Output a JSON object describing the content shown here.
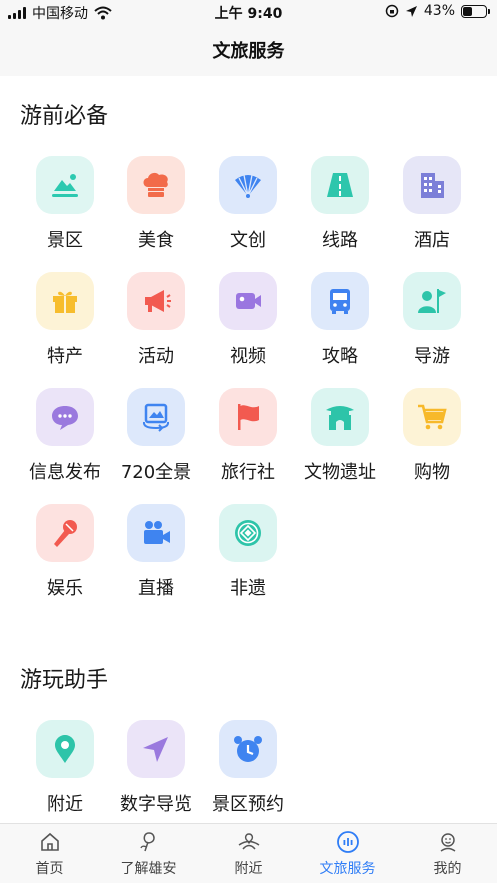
{
  "status": {
    "carrier": "中国移动",
    "time": "上午 9:40",
    "battery": "43%",
    "battery_level": 0.43
  },
  "nav": {
    "title": "文旅服务"
  },
  "sections": [
    {
      "title": "游前必备",
      "items": [
        {
          "label": "景区",
          "icon": "landscape-icon",
          "bg": "#dff6f2",
          "fg": "#2cc9b0"
        },
        {
          "label": "美食",
          "icon": "chef-hat-icon",
          "bg": "#fde3dc",
          "fg": "#f26b4a"
        },
        {
          "label": "文创",
          "icon": "fan-icon",
          "bg": "#dde8fb",
          "fg": "#3f84f0"
        },
        {
          "label": "线路",
          "icon": "road-icon",
          "bg": "#dcf5f0",
          "fg": "#2ec6ac"
        },
        {
          "label": "酒店",
          "icon": "building-icon",
          "bg": "#e6e6f7",
          "fg": "#7c7fd8"
        },
        {
          "label": "特产",
          "icon": "gift-icon",
          "bg": "#fdf3d6",
          "fg": "#f7bd2d"
        },
        {
          "label": "活动",
          "icon": "megaphone-icon",
          "bg": "#fde2e0",
          "fg": "#f25a50"
        },
        {
          "label": "视频",
          "icon": "video-camera-icon",
          "bg": "#ebe3f8",
          "fg": "#9a76e0"
        },
        {
          "label": "攻略",
          "icon": "bus-icon",
          "bg": "#dee9fb",
          "fg": "#3f82f0"
        },
        {
          "label": "导游",
          "icon": "guide-flag-icon",
          "bg": "#dbf5f1",
          "fg": "#2dc4a9"
        },
        {
          "label": "信息发布",
          "icon": "chat-bubble-icon",
          "bg": "#ebe4f8",
          "fg": "#9a79de"
        },
        {
          "label": "720全景",
          "icon": "panorama-icon",
          "bg": "#dde8fb",
          "fg": "#3f84f0"
        },
        {
          "label": "旅行社",
          "icon": "red-flag-icon",
          "bg": "#fde2e0",
          "fg": "#f25a50"
        },
        {
          "label": "文物遗址",
          "icon": "pavilion-icon",
          "bg": "#dbf5f1",
          "fg": "#2dc4a9"
        },
        {
          "label": "购物",
          "icon": "cart-icon",
          "bg": "#fdf3d6",
          "fg": "#f7b92a"
        },
        {
          "label": "娱乐",
          "icon": "microphone-icon",
          "bg": "#fde2e0",
          "fg": "#f25a50"
        },
        {
          "label": "直播",
          "icon": "live-camera-icon",
          "bg": "#dde8fb",
          "fg": "#3f84f0"
        },
        {
          "label": "非遗",
          "icon": "heritage-emblem-icon",
          "bg": "#dbf5f1",
          "fg": "#2dc4a9"
        }
      ]
    },
    {
      "title": "游玩助手",
      "items": [
        {
          "label": "附近",
          "icon": "location-pin-icon",
          "bg": "#dbf5f1",
          "fg": "#2dc4a9"
        },
        {
          "label": "数字导览",
          "icon": "navigation-arrow-icon",
          "bg": "#ebe4f8",
          "fg": "#9a79de"
        },
        {
          "label": "景区预约",
          "icon": "alarm-clock-icon",
          "bg": "#dde8fb",
          "fg": "#3f84f0"
        }
      ]
    }
  ],
  "tabs": [
    {
      "label": "首页",
      "icon": "home-icon",
      "active": false
    },
    {
      "label": "了解雄安",
      "icon": "rose-icon",
      "active": false
    },
    {
      "label": "附近",
      "icon": "nearby-icon",
      "active": false
    },
    {
      "label": "文旅服务",
      "icon": "service-icon",
      "active": true
    },
    {
      "label": "我的",
      "icon": "profile-icon",
      "active": false
    }
  ],
  "colors": {
    "accent": "#2f7df6"
  }
}
